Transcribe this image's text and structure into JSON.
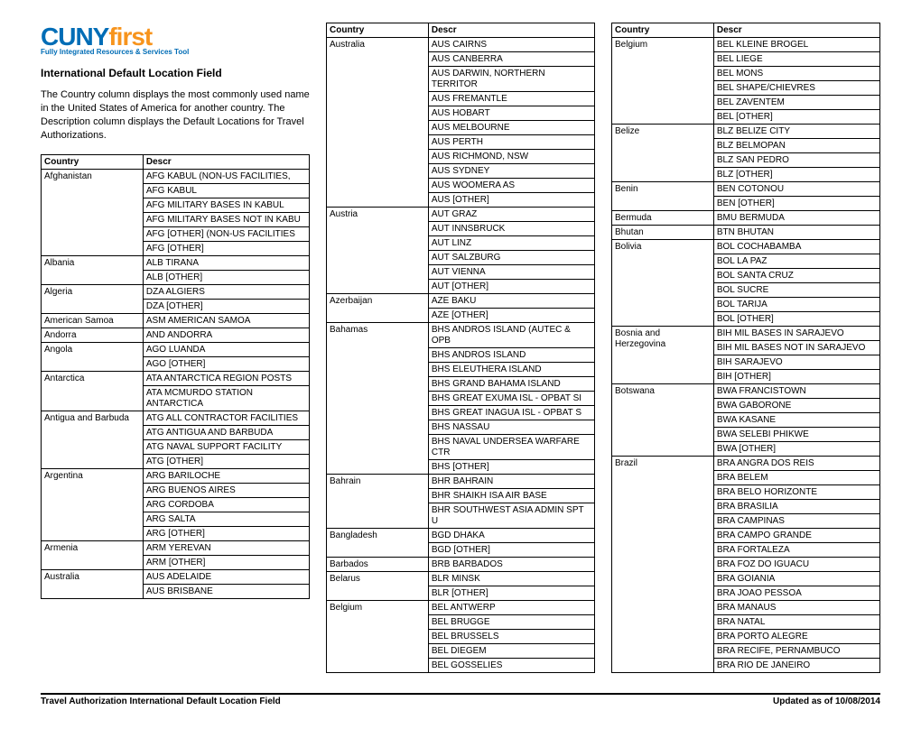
{
  "logo": {
    "part1": "CUNY",
    "part2": "first",
    "sub": "Fully Integrated Resources & Services Tool"
  },
  "title": "International Default Location Field",
  "intro": "The Country column displays the most commonly used name in the United States of America for another country.  The Description column displays the Default Locations for Travel Authorizations.",
  "headers": {
    "country": "Country",
    "descr": "Descr"
  },
  "col1": [
    {
      "country": "Afghanistan",
      "items": [
        "AFG KABUL (NON-US FACILITIES,",
        "AFG KABUL",
        "AFG MILITARY BASES IN KABUL",
        "AFG MILITARY BASES NOT IN KABU",
        "AFG [OTHER] (NON-US FACILITIES",
        "AFG [OTHER]"
      ]
    },
    {
      "country": "Albania",
      "items": [
        "ALB TIRANA",
        "ALB [OTHER]"
      ]
    },
    {
      "country": "Algeria",
      "items": [
        "DZA ALGIERS",
        "DZA [OTHER]"
      ]
    },
    {
      "country": "American Samoa",
      "items": [
        "ASM AMERICAN SAMOA"
      ]
    },
    {
      "country": "Andorra",
      "items": [
        "AND ANDORRA"
      ]
    },
    {
      "country": "Angola",
      "items": [
        "AGO LUANDA",
        "AGO [OTHER]"
      ]
    },
    {
      "country": "Antarctica",
      "items": [
        "ATA ANTARCTICA REGION POSTS",
        "ATA MCMURDO STATION ANTARCTICA"
      ]
    },
    {
      "country": "Antigua and Barbuda",
      "items": [
        "ATG ALL CONTRACTOR FACILITIES",
        "ATG ANTIGUA AND BARBUDA",
        "ATG NAVAL SUPPORT FACILITY",
        "ATG [OTHER]"
      ]
    },
    {
      "country": "Argentina",
      "items": [
        "ARG BARILOCHE",
        "ARG BUENOS AIRES",
        "ARG CORDOBA",
        "ARG SALTA",
        "ARG [OTHER]"
      ]
    },
    {
      "country": "Armenia",
      "items": [
        "ARM YEREVAN",
        "ARM [OTHER]"
      ]
    },
    {
      "country": "Australia",
      "items": [
        "AUS ADELAIDE",
        "AUS BRISBANE"
      ]
    }
  ],
  "col2": [
    {
      "country": "Australia",
      "items": [
        "AUS CAIRNS",
        "AUS CANBERRA",
        "AUS DARWIN,  NORTHERN TERRITOR",
        "AUS FREMANTLE",
        "AUS HOBART",
        "AUS MELBOURNE",
        "AUS PERTH",
        "AUS RICHMOND, NSW",
        "AUS SYDNEY",
        "AUS WOOMERA AS",
        "AUS [OTHER]"
      ]
    },
    {
      "country": "Austria",
      "items": [
        "AUT GRAZ",
        "AUT INNSBRUCK",
        "AUT LINZ",
        "AUT SALZBURG",
        "AUT VIENNA",
        "AUT [OTHER]"
      ]
    },
    {
      "country": "Azerbaijan",
      "items": [
        "AZE BAKU",
        "AZE [OTHER]"
      ]
    },
    {
      "country": "Bahamas",
      "items": [
        "BHS ANDROS ISLAND (AUTEC & OPB",
        "BHS ANDROS ISLAND",
        "BHS ELEUTHERA ISLAND",
        "BHS GRAND BAHAMA ISLAND",
        "BHS GREAT EXUMA ISL - OPBAT SI",
        "BHS GREAT INAGUA ISL - OPBAT S",
        "BHS NASSAU",
        "BHS NAVAL UNDERSEA WARFARE CTR",
        "BHS [OTHER]"
      ]
    },
    {
      "country": "Bahrain",
      "items": [
        "BHR BAHRAIN",
        "BHR SHAIKH ISA AIR BASE",
        "BHR SOUTHWEST ASIA ADMIN SPT U"
      ]
    },
    {
      "country": "Bangladesh",
      "items": [
        "BGD DHAKA",
        "BGD [OTHER]"
      ]
    },
    {
      "country": "Barbados",
      "items": [
        "BRB BARBADOS"
      ]
    },
    {
      "country": "Belarus",
      "items": [
        "BLR MINSK",
        "BLR [OTHER]"
      ]
    },
    {
      "country": "Belgium",
      "items": [
        "BEL ANTWERP",
        "BEL BRUGGE",
        "BEL BRUSSELS",
        "BEL DIEGEM",
        "BEL GOSSELIES"
      ]
    }
  ],
  "col3": [
    {
      "country": "Belgium",
      "items": [
        "BEL KLEINE BROGEL",
        "BEL LIEGE",
        "BEL MONS",
        "BEL SHAPE/CHIEVRES",
        "BEL ZAVENTEM",
        "BEL [OTHER]"
      ]
    },
    {
      "country": "Belize",
      "items": [
        "BLZ BELIZE CITY",
        "BLZ BELMOPAN",
        "BLZ SAN PEDRO",
        "BLZ [OTHER]"
      ]
    },
    {
      "country": "Benin",
      "items": [
        "BEN COTONOU",
        "BEN [OTHER]"
      ]
    },
    {
      "country": "Bermuda",
      "items": [
        "BMU BERMUDA"
      ]
    },
    {
      "country": "Bhutan",
      "items": [
        "BTN BHUTAN"
      ]
    },
    {
      "country": "Bolivia",
      "items": [
        "BOL COCHABAMBA",
        "BOL LA PAZ",
        "BOL SANTA CRUZ",
        "BOL SUCRE",
        "BOL TARIJA",
        "BOL [OTHER]"
      ]
    },
    {
      "country": "Bosnia and Herzegovina",
      "items": [
        "BIH MIL BASES IN SARAJEVO",
        "BIH MIL BASES NOT IN SARAJEVO",
        "BIH SARAJEVO",
        "BIH [OTHER]"
      ]
    },
    {
      "country": "Botswana",
      "items": [
        "BWA FRANCISTOWN",
        "BWA GABORONE",
        "BWA KASANE",
        "BWA SELEBI PHIKWE",
        "BWA [OTHER]"
      ]
    },
    {
      "country": "Brazil",
      "items": [
        "BRA ANGRA DOS REIS",
        "BRA BELEM",
        "BRA BELO HORIZONTE",
        "BRA BRASILIA",
        "BRA CAMPINAS",
        "BRA CAMPO GRANDE",
        "BRA FORTALEZA",
        "BRA FOZ DO IGUACU",
        "BRA GOIANIA",
        "BRA JOAO PESSOA",
        "BRA MANAUS",
        "BRA NATAL",
        "BRA PORTO ALEGRE",
        "BRA RECIFE, PERNAMBUCO",
        "BRA RIO DE JANEIRO"
      ]
    }
  ],
  "footer": {
    "left": "Travel Authorization International Default Location Field",
    "right": "Updated as of 10/08/2014"
  }
}
